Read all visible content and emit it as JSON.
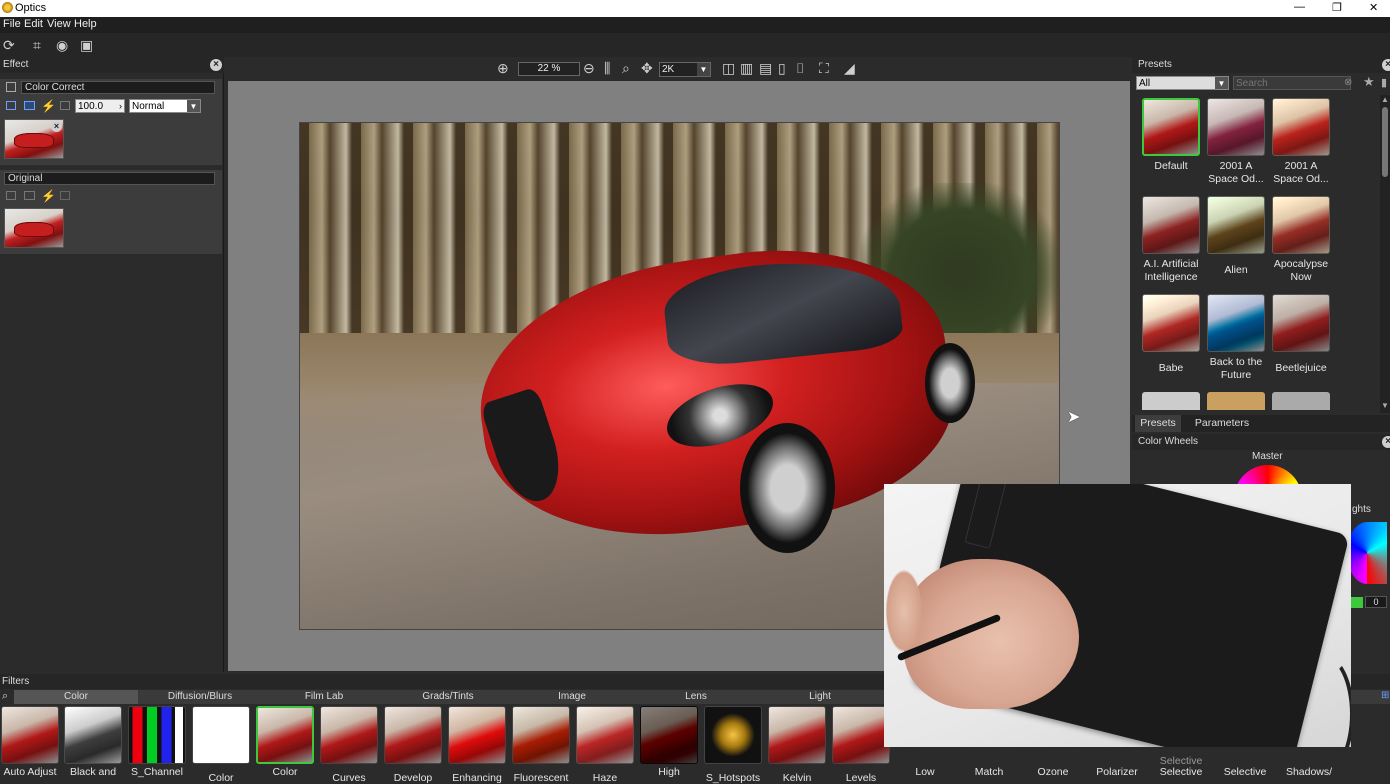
{
  "app": {
    "title": "Optics"
  },
  "menu": {
    "items": [
      "File",
      "Edit",
      "View",
      "Help"
    ]
  },
  "window_controls": {
    "minimize": "—",
    "restore": "❐",
    "close": "✕"
  },
  "effect_panel": {
    "title": "Effect",
    "layer_name": "Color Correct",
    "opacity": "100.0",
    "blend_mode": "Normal",
    "original_label": "Original"
  },
  "viewer": {
    "zoom": "22 %",
    "resolution": "2K"
  },
  "presets_panel": {
    "title": "Presets",
    "category": "All",
    "search_placeholder": "Search",
    "items": [
      {
        "name": "Default",
        "line2": ""
      },
      {
        "name": "2001 A",
        "line2": "Space Od..."
      },
      {
        "name": "2001 A",
        "line2": "Space Od..."
      },
      {
        "name": "A.I. Artificial",
        "line2": "Intelligence"
      },
      {
        "name": "Alien",
        "line2": ""
      },
      {
        "name": "Apocalypse",
        "line2": "Now"
      },
      {
        "name": "Babe",
        "line2": ""
      },
      {
        "name": "Back to the",
        "line2": "Future"
      },
      {
        "name": "Beetlejuice",
        "line2": ""
      }
    ],
    "tabs": [
      "Presets",
      "Parameters"
    ]
  },
  "color_wheels": {
    "title": "Color Wheels",
    "master_label": "Master",
    "highlights_label": "ghts",
    "value": "0"
  },
  "filters": {
    "title": "Filters",
    "categories": [
      "Color",
      "Diffusion/Blurs",
      "Film Lab",
      "Grads/Tints",
      "Image",
      "Lens",
      "Light"
    ],
    "items": [
      {
        "label": "Auto Adjust"
      },
      {
        "label": "Black and"
      },
      {
        "label": "S_Channel"
      },
      {
        "label": "Color"
      },
      {
        "label": "Color"
      },
      {
        "label": "Curves"
      },
      {
        "label": "Develop"
      },
      {
        "label": "Enhancing"
      },
      {
        "label": "Fluorescent"
      },
      {
        "label": "Haze"
      },
      {
        "label": "High"
      },
      {
        "label": "S_Hotspots"
      },
      {
        "label": "Kelvin"
      },
      {
        "label": "Levels"
      },
      {
        "label": "Low"
      },
      {
        "label": "Match"
      },
      {
        "label": "Ozone"
      },
      {
        "label": "Polarizer"
      },
      {
        "label": "Selective"
      },
      {
        "label": "Selective"
      },
      {
        "label": "Shadows/"
      }
    ],
    "extra_label": "Selective"
  },
  "colors": {
    "accent_green": "#3dc83d",
    "car_red": "#c41e1e",
    "panel_bg": "#2b2b2b",
    "canvas_bg": "#808080"
  }
}
